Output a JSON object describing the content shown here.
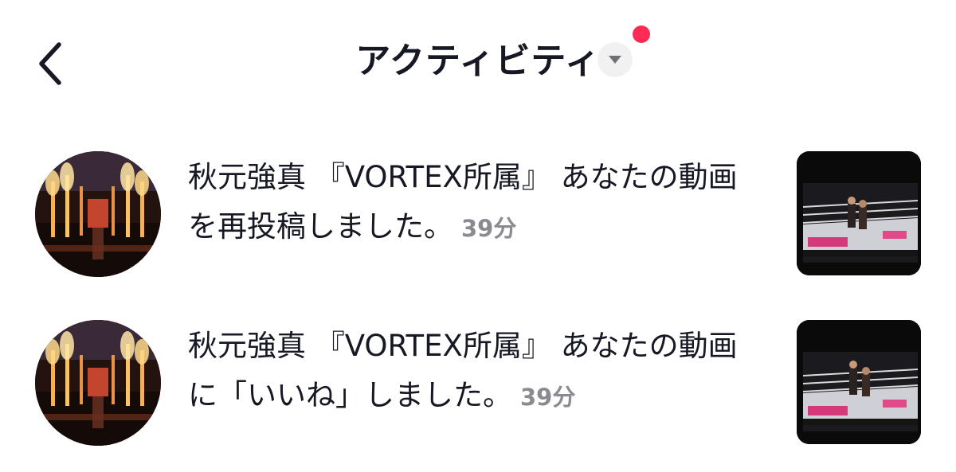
{
  "header": {
    "title": "アクティビティ"
  },
  "notifications": [
    {
      "user_name": "秋元強真 『VORTEX所属』",
      "message_line1_suffix": " あなたの動画",
      "message_line2": "を再投稿しました。",
      "time": "39分"
    },
    {
      "user_name": "秋元強真 『VORTEX所属』",
      "message_line1_suffix": " あなたの動画",
      "message_line2": "に「いいね」しました。",
      "time": "39分"
    }
  ],
  "colors": {
    "notification_dot": "#fe2c55",
    "time_text": "#8a8b91",
    "dropdown_bg": "#f1f1f2"
  },
  "icons": {
    "back": "chevron-left-icon",
    "dropdown": "caret-down-icon"
  }
}
